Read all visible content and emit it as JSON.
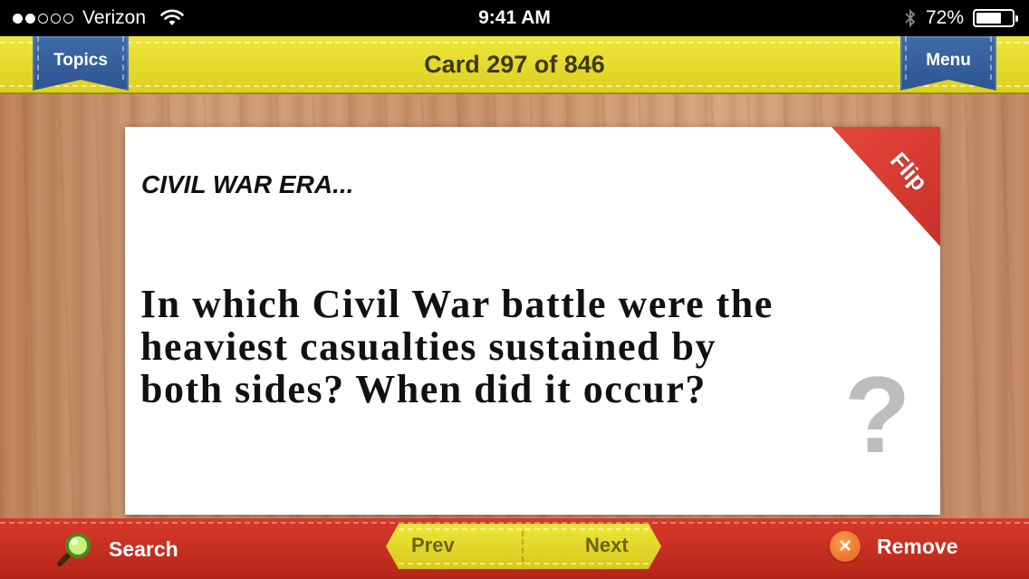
{
  "status_bar": {
    "carrier": "Verizon",
    "signal_bars_filled": 2,
    "signal_bars_total": 5,
    "time": "9:41 AM",
    "battery_percent": "72%",
    "battery_level": 0.72
  },
  "header": {
    "topics_label": "Topics",
    "card_counter": "Card 297 of 846",
    "menu_label": "Menu"
  },
  "card": {
    "topic": "CIVIL WAR ERA...",
    "question": "In which Civil War battle were the heaviest casualties sustained by both sides? When did it occur?",
    "flip_label": "Flip",
    "question_mark": "?"
  },
  "footer": {
    "search_label": "Search",
    "prev_label": "Prev",
    "next_label": "Next",
    "remove_label": "Remove",
    "remove_icon": "×"
  },
  "colors": {
    "header_yellow": "#e8dd2e",
    "ribbon_blue": "#3561a0",
    "footer_red": "#c83020",
    "flip_red": "#d9392f",
    "remove_orange": "#e8702a"
  }
}
